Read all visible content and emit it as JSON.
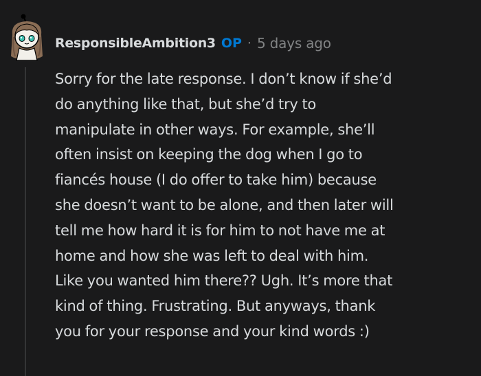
{
  "comment": {
    "author": "ResponsibleAmbition3",
    "badge": "OP",
    "separator": "·",
    "time": "5 days ago",
    "body": "Sorry for the late response. I don’t know if she’d\ndo anything like that, but she’d try to\nmanipulate in other ways. For example, she’ll\noften insist on keeping the dog when I go to\nfiancés house (I do offer to take him) because\nshe doesn’t want to be alone, and then later will\ntell me how hard it is for him to not have me at\nhome and how she was left to deal with him.\nLike you wanted him there?? Ugh. It’s more that\nkind of thing. Frustrating. But anyways, thank\nyou for your response and your kind words :)"
  },
  "colors": {
    "background": "#1a1a1b",
    "text": "#d7dadc",
    "meta": "#818384",
    "op_badge": "#0079d3",
    "thread_line": "#343536"
  }
}
